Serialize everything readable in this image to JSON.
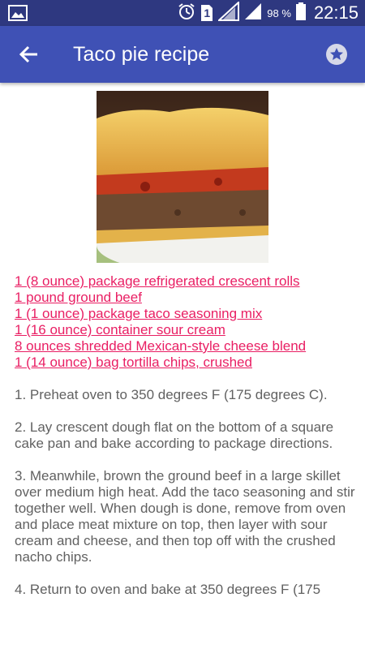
{
  "status_bar": {
    "battery_percent": "98 %",
    "time": "22:15",
    "sim_label": "1",
    "icons": [
      "gallery-icon",
      "alarm-icon",
      "sim-icon",
      "signal-icon",
      "signal-icon",
      "battery-icon"
    ]
  },
  "app_bar": {
    "title": "Taco pie recipe",
    "back_icon": "arrow-left-icon",
    "favorite_icon": "star-icon"
  },
  "recipe": {
    "image_alt": "taco-pie-photo",
    "ingredients": [
      "1 (8 ounce) package refrigerated crescent rolls",
      "1 pound ground beef",
      "1 (1 ounce) package taco seasoning mix",
      "1 (16 ounce) container sour cream",
      "8 ounces shredded Mexican-style cheese blend",
      "1 (14 ounce) bag tortilla chips, crushed"
    ],
    "steps": [
      "1. Preheat oven to 350 degrees F (175 degrees C).",
      "2. Lay crescent dough flat on the bottom of a square cake pan and bake according to package directions.",
      "3. Meanwhile, brown the ground beef in a large skillet over medium high heat. Add the taco seasoning and stir together well. When dough is done, remove from oven and place meat mixture on top, then layer with sour cream and cheese, and then top off with the crushed nacho chips.",
      "4. Return to oven and bake at 350 degrees F (175"
    ]
  },
  "colors": {
    "status_bar": "#2e3880",
    "app_bar": "#3f51b5",
    "link": "#e91e63",
    "body_text": "#616161"
  }
}
